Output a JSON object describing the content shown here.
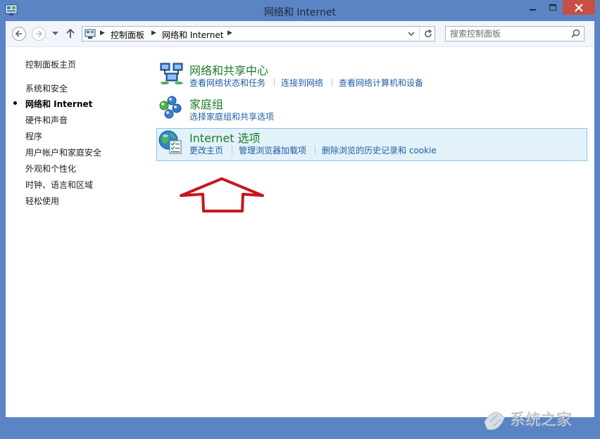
{
  "window": {
    "title": "网络和 Internet"
  },
  "address": {
    "crumbs": [
      "控制面板",
      "网络和 Internet"
    ]
  },
  "search": {
    "placeholder": "搜索控制面板"
  },
  "left_nav": {
    "home": "控制面板主页",
    "items": [
      {
        "label": "系统和安全"
      },
      {
        "label": "网络和 Internet",
        "current": true
      },
      {
        "label": "硬件和声音"
      },
      {
        "label": "程序"
      },
      {
        "label": "用户帐户和家庭安全"
      },
      {
        "label": "外观和个性化"
      },
      {
        "label": "时钟、语言和区域"
      },
      {
        "label": "轻松使用"
      }
    ]
  },
  "categories": [
    {
      "title": "网络和共享中心",
      "icon": "network-sharing-icon",
      "links": [
        "查看网络状态和任务",
        "连接到网络",
        "查看网络计算机和设备"
      ]
    },
    {
      "title": "家庭组",
      "icon": "homegroup-icon",
      "links": [
        "选择家庭组和共享选项"
      ]
    },
    {
      "title": "Internet 选项",
      "icon": "internet-options-icon",
      "highlighted": true,
      "links": [
        "更改主页",
        "管理浏览器加载项",
        "删除浏览的历史记录和 cookie"
      ]
    }
  ],
  "annotation": {
    "type": "red-outline-arrow-up",
    "color": "#c8161d"
  },
  "watermark": {
    "text": "系统之家"
  },
  "colors": {
    "title_bar": "#5b84c4",
    "close_button": "#c74f43",
    "category_title": "#1e7a2a",
    "link": "#1c5ea6",
    "highlight_bg": "#e3f1fa",
    "highlight_border": "#8fc4e6"
  }
}
